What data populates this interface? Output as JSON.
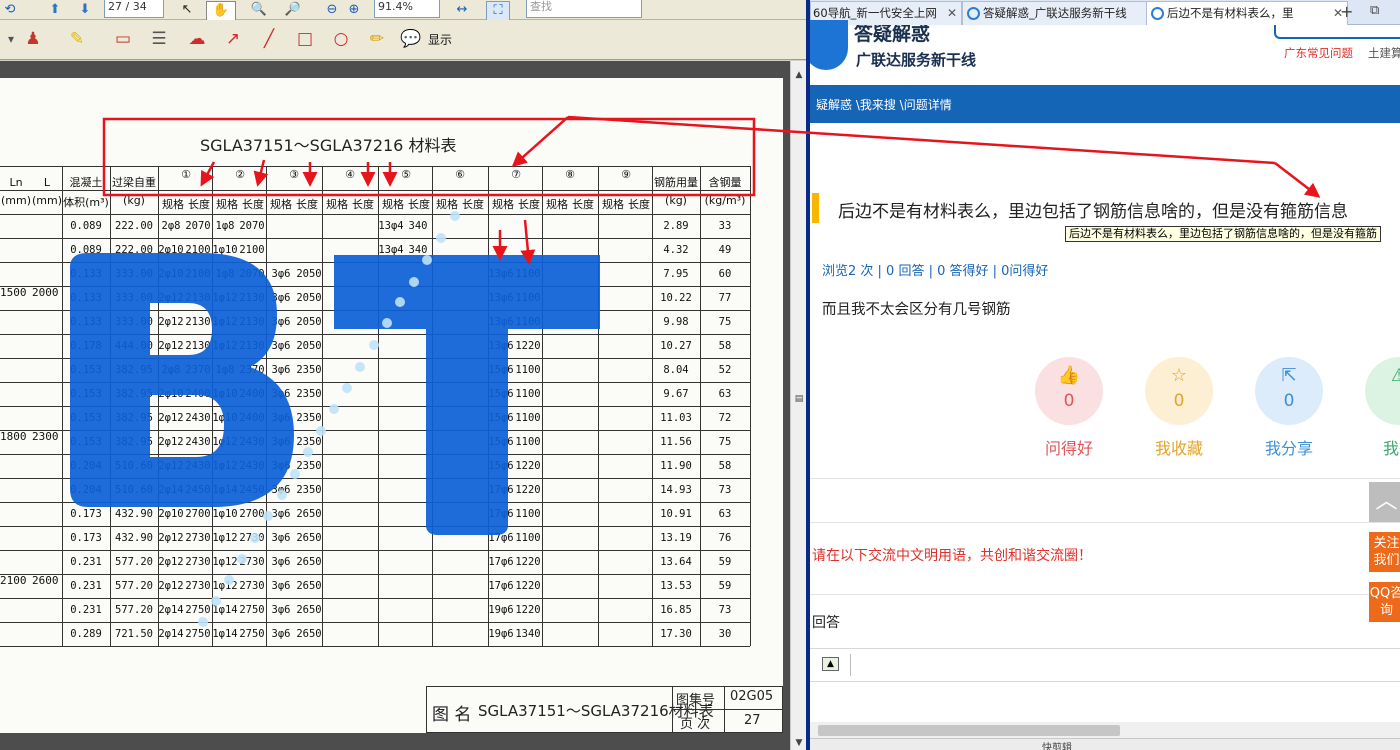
{
  "pdf_viewer": {
    "page_field": "27 / 34",
    "zoom_field": "91.4%",
    "search_placeholder": "查找",
    "display_menu": "显示",
    "icons": [
      "home-icon",
      "up-arrow-icon",
      "down-arrow-icon",
      "select-tool-icon",
      "hand-tool-icon",
      "zoom-out-icon",
      "zoom-in-icon",
      "fit-width-icon",
      "fit-page-icon",
      "stamp-icon",
      "highlight-icon",
      "comment-icon",
      "note-icon",
      "cloud-icon",
      "arrow-tool-icon",
      "line-tool-icon",
      "rectangle-tool-icon",
      "ellipse-tool-icon",
      "pencil-icon",
      "show-icon"
    ]
  },
  "document": {
    "title": "SGLA37151～SGLA37216 材料表",
    "header_cols": {
      "ln": "Ln",
      "l": "L",
      "ln_unit": "(mm)",
      "l_unit": "(mm)",
      "concrete": "混凝土",
      "concrete2": "体积(m³)",
      "beam_weight": "过梁自重",
      "beam_weight_unit": "(kg)",
      "steel_total": "钢筋用量",
      "steel_total_unit": "(kg)",
      "steel_ratio": "含钢量",
      "steel_ratio_unit": "(kg/m³)",
      "spec": "规格",
      "length": "长度",
      "circles": [
        "①",
        "②",
        "③",
        "④",
        "⑤",
        "⑥",
        "⑦",
        "⑧",
        "⑨"
      ]
    },
    "groups": [
      {
        "ln": "1500",
        "l": "2000"
      },
      {
        "ln": "1800",
        "l": "2300"
      },
      {
        "ln": "2100",
        "l": "2600"
      }
    ],
    "rows": [
      {
        "vol": "0.089",
        "wt": "222.00",
        "s1": "2φ8",
        "l1": "2070",
        "s2": "1φ8",
        "l2": "2070",
        "s3": "",
        "l3": "",
        "s5": "13φ4",
        "l5": "340",
        "s7": "",
        "l7": "",
        "kg": "2.89",
        "ratio": "33"
      },
      {
        "vol": "0.089",
        "wt": "222.00",
        "s1": "2φ10",
        "l1": "2100",
        "s2": "1φ10",
        "l2": "2100",
        "s3": "",
        "l3": "",
        "s5": "13φ4",
        "l5": "340",
        "s7": "",
        "l7": "",
        "kg": "4.32",
        "ratio": "49"
      },
      {
        "vol": "0.133",
        "wt": "333.00",
        "s1": "2φ10",
        "l1": "2100",
        "s2": "1φ8",
        "l2": "2070",
        "s3": "3φ6",
        "l3": "2050",
        "s5": "",
        "l5": "",
        "s7": "13φ6",
        "l7": "1100",
        "kg": "7.95",
        "ratio": "60"
      },
      {
        "vol": "0.133",
        "wt": "333.00",
        "s1": "2φ12",
        "l1": "2130",
        "s2": "1φ12",
        "l2": "2130",
        "s3": "3φ6",
        "l3": "2050",
        "s5": "",
        "l5": "",
        "s7": "13φ6",
        "l7": "1100",
        "kg": "10.22",
        "ratio": "77"
      },
      {
        "vol": "0.133",
        "wt": "333.00",
        "s1": "2φ12",
        "l1": "2130",
        "s2": "1φ12",
        "l2": "2130",
        "s3": "3φ6",
        "l3": "2050",
        "s5": "",
        "l5": "",
        "s7": "13φ6",
        "l7": "1100",
        "kg": "9.98",
        "ratio": "75"
      },
      {
        "vol": "0.178",
        "wt": "444.00",
        "s1": "2φ12",
        "l1": "2130",
        "s2": "1φ12",
        "l2": "2130",
        "s3": "3φ6",
        "l3": "2050",
        "s5": "",
        "l5": "",
        "s7": "13φ6",
        "l7": "1220",
        "kg": "10.27",
        "ratio": "58"
      },
      {
        "vol": "0.153",
        "wt": "382.95",
        "s1": "2φ8",
        "l1": "2370",
        "s2": "1φ8",
        "l2": "2370",
        "s3": "3φ6",
        "l3": "2350",
        "s5": "",
        "l5": "",
        "s7": "15φ6",
        "l7": "1100",
        "kg": "8.04",
        "ratio": "52"
      },
      {
        "vol": "0.153",
        "wt": "382.95",
        "s1": "2φ10",
        "l1": "2400",
        "s2": "1φ10",
        "l2": "2400",
        "s3": "3φ6",
        "l3": "2350",
        "s5": "",
        "l5": "",
        "s7": "15φ6",
        "l7": "1100",
        "kg": "9.67",
        "ratio": "63"
      },
      {
        "vol": "0.153",
        "wt": "382.95",
        "s1": "2φ12",
        "l1": "2430",
        "s2": "1φ10",
        "l2": "2400",
        "s3": "3φ6",
        "l3": "2350",
        "s5": "",
        "l5": "",
        "s7": "15φ6",
        "l7": "1100",
        "kg": "11.03",
        "ratio": "72"
      },
      {
        "vol": "0.153",
        "wt": "382.95",
        "s1": "2φ12",
        "l1": "2430",
        "s2": "1φ12",
        "l2": "2430",
        "s3": "3φ6",
        "l3": "2350",
        "s5": "",
        "l5": "",
        "s7": "15φ6",
        "l7": "1100",
        "kg": "11.56",
        "ratio": "75"
      },
      {
        "vol": "0.204",
        "wt": "510.60",
        "s1": "2φ12",
        "l1": "2430",
        "s2": "1φ12",
        "l2": "2430",
        "s3": "3φ6",
        "l3": "2350",
        "s5": "",
        "l5": "",
        "s7": "15φ6",
        "l7": "1220",
        "kg": "11.90",
        "ratio": "58"
      },
      {
        "vol": "0.204",
        "wt": "510.60",
        "s1": "2φ14",
        "l1": "2450",
        "s2": "1φ14",
        "l2": "2450",
        "s3": "3φ6",
        "l3": "2350",
        "s5": "",
        "l5": "",
        "s7": "17φ6",
        "l7": "1220",
        "kg": "14.93",
        "ratio": "73"
      },
      {
        "vol": "0.173",
        "wt": "432.90",
        "s1": "2φ10",
        "l1": "2700",
        "s2": "1φ10",
        "l2": "2700",
        "s3": "3φ6",
        "l3": "2650",
        "s5": "",
        "l5": "",
        "s7": "17φ6",
        "l7": "1100",
        "kg": "10.91",
        "ratio": "63"
      },
      {
        "vol": "0.173",
        "wt": "432.90",
        "s1": "2φ12",
        "l1": "2730",
        "s2": "1φ12",
        "l2": "2730",
        "s3": "3φ6",
        "l3": "2650",
        "s5": "",
        "l5": "",
        "s7": "17φ6",
        "l7": "1100",
        "kg": "13.19",
        "ratio": "76"
      },
      {
        "vol": "0.231",
        "wt": "577.20",
        "s1": "2φ12",
        "l1": "2730",
        "s2": "1φ12",
        "l2": "2730",
        "s3": "3φ6",
        "l3": "2650",
        "s5": "",
        "l5": "",
        "s7": "17φ6",
        "l7": "1220",
        "kg": "13.64",
        "ratio": "59"
      },
      {
        "vol": "0.231",
        "wt": "577.20",
        "s1": "2φ12",
        "l1": "2730",
        "s2": "1φ12",
        "l2": "2730",
        "s3": "3φ6",
        "l3": "2650",
        "s5": "",
        "l5": "",
        "s7": "17φ6",
        "l7": "1220",
        "kg": "13.53",
        "ratio": "59"
      },
      {
        "vol": "0.231",
        "wt": "577.20",
        "s1": "2φ14",
        "l1": "2750",
        "s2": "1φ14",
        "l2": "2750",
        "s3": "3φ6",
        "l3": "2650",
        "s5": "",
        "l5": "",
        "s7": "19φ6",
        "l7": "1220",
        "kg": "16.85",
        "ratio": "73"
      },
      {
        "vol": "0.289",
        "wt": "721.50",
        "s1": "2φ14",
        "l1": "2750",
        "s2": "1φ14",
        "l2": "2750",
        "s3": "3φ6",
        "l3": "2650",
        "s5": "",
        "l5": "",
        "s7": "19φ6",
        "l7": "1340",
        "kg": "17.30",
        "ratio": "30"
      }
    ],
    "footer": {
      "name_label": "图 名",
      "name_value": "SGLA37151～SGLA37216材料表",
      "atlas_label": "图集号",
      "atlas_value": "02G05",
      "page_label": "页 次",
      "page_value": "27"
    },
    "watermark": "BT"
  },
  "browser": {
    "tabs": [
      {
        "label": "60导航_新一代安全上网",
        "active": false
      },
      {
        "label": "答疑解惑_广联达服务新干线",
        "active": false
      },
      {
        "label": "后边不是有材料表么，里",
        "active": true
      }
    ],
    "logo": {
      "title": "答疑解惑",
      "subtitle": "广联达服务新干线"
    },
    "top_links": [
      "广东常见问题",
      "土建算"
    ],
    "breadcrumb": "疑解惑 \\我来搜 \\问题详情",
    "question": "后边不是有材料表么，里边包括了钢筋信息啥的，但是没有箍筋信息",
    "tooltip": "后边不是有材料表么，里边包括了钢筋信息啥的，但是没有箍筋",
    "stats": "浏览2 次 | 0 回答 | 0 答得好 | 0问得好",
    "body": "而且我不太会区分有几号钢筋",
    "actions": [
      {
        "label": "问得好",
        "count": "0",
        "icon": "thumbs-up-icon",
        "color": "#e0555a",
        "bg": "#fbe0e1"
      },
      {
        "label": "我收藏",
        "count": "0",
        "icon": "star-icon",
        "color": "#e3a42b",
        "bg": "#fcefd4"
      },
      {
        "label": "我分享",
        "count": "0",
        "icon": "share-icon",
        "color": "#3d8fd8",
        "bg": "#dcecfa"
      },
      {
        "label": "我举",
        "count": "",
        "icon": "warning-icon",
        "color": "#3aa86a",
        "bg": "#dcf3e4"
      }
    ],
    "notice": "请在以下交流中文明用语，共创和谐交流圈！",
    "answer_label": "回答",
    "side_buttons": {
      "follow": "关注我们",
      "qq": "QQ咨询"
    },
    "status": "快剪辑"
  },
  "colors": {
    "annotation_red": "#e8141c",
    "watermark_blue": "#0a5fd6",
    "header_blue": "#1565b7",
    "side_orange": "#ee6a1b"
  }
}
